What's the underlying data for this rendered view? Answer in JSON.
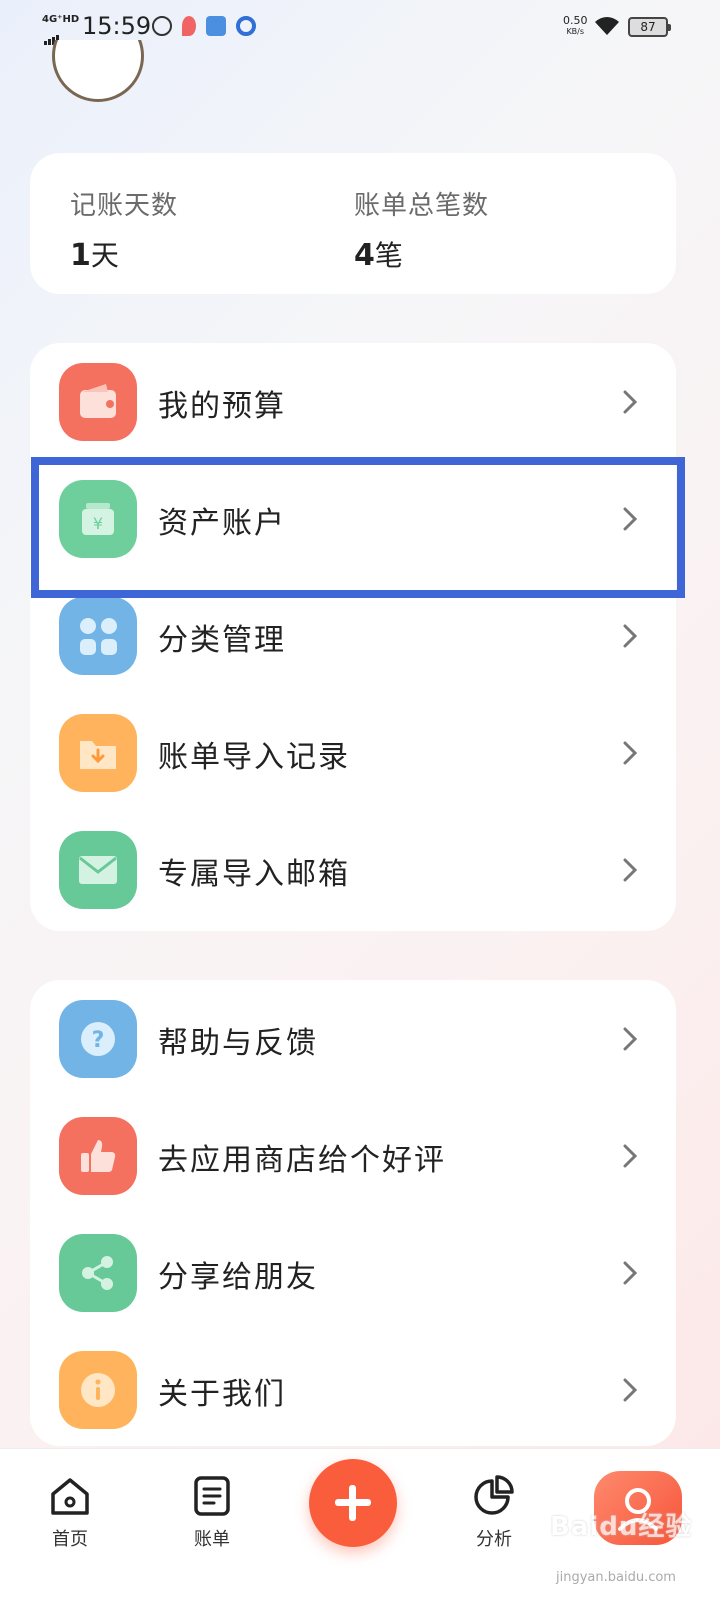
{
  "status_bar": {
    "network": "4G⁺HD",
    "time": "15:59",
    "speed_value": "0.50",
    "speed_unit": "KB/s",
    "battery": "87"
  },
  "stats": {
    "days_label": "记账天数",
    "days_value": "1",
    "days_unit": "天",
    "bills_label": "账单总笔数",
    "bills_value": "4",
    "bills_unit": "笔"
  },
  "menu_group_1": [
    {
      "label": "我的预算",
      "icon": "wallet-icon",
      "color": "#f4705f"
    },
    {
      "label": "资产账户",
      "icon": "money-bag-icon",
      "color": "#6fcf9c"
    },
    {
      "label": "分类管理",
      "icon": "grid-icon",
      "color": "#72b4e6"
    },
    {
      "label": "账单导入记录",
      "icon": "folder-import-icon",
      "color": "#ffb35c"
    },
    {
      "label": "专属导入邮箱",
      "icon": "mail-icon",
      "color": "#66c997"
    }
  ],
  "menu_group_2": [
    {
      "label": "帮助与反馈",
      "icon": "help-icon",
      "color": "#72b4e6"
    },
    {
      "label": "去应用商店给个好评",
      "icon": "thumbs-up-icon",
      "color": "#f4705f"
    },
    {
      "label": "分享给朋友",
      "icon": "share-icon",
      "color": "#66c997"
    },
    {
      "label": "关于我们",
      "icon": "info-icon",
      "color": "#ffb35c"
    }
  ],
  "bottom_nav": {
    "home": "首页",
    "bills": "账单",
    "analysis": "分析"
  },
  "watermark": {
    "text": "Baidu经验",
    "sub": "jingyan.baidu.com"
  }
}
